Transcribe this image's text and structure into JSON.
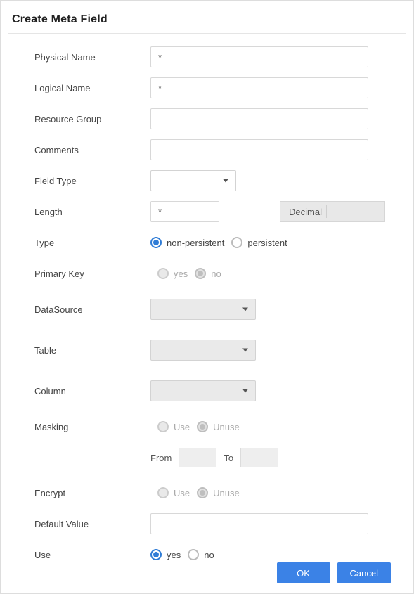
{
  "title": "Create Meta Field",
  "labels": {
    "physicalName": "Physical Name",
    "logicalName": "Logical Name",
    "resourceGroup": "Resource Group",
    "comments": "Comments",
    "fieldType": "Field Type",
    "length": "Length",
    "type": "Type",
    "primaryKey": "Primary Key",
    "dataSource": "DataSource",
    "table": "Table",
    "column": "Column",
    "masking": "Masking",
    "encrypt": "Encrypt",
    "defaultValue": "Default Value",
    "use": "Use",
    "from": "From",
    "to": "To",
    "decimal": "Decimal"
  },
  "placeholders": {
    "star": "*"
  },
  "options": {
    "type": {
      "nonpersistent": "non-persistent",
      "persistent": "persistent"
    },
    "yesno": {
      "yes": "yes",
      "no": "no"
    },
    "useunuse": {
      "use": "Use",
      "unuse": "Unuse"
    }
  },
  "buttons": {
    "ok": "OK",
    "cancel": "Cancel"
  },
  "state": {
    "typeSelected": "nonpersistent",
    "primaryKeySelected": "no",
    "maskingSelected": "unuse",
    "encryptSelected": "unuse",
    "useSelected": "yes"
  }
}
